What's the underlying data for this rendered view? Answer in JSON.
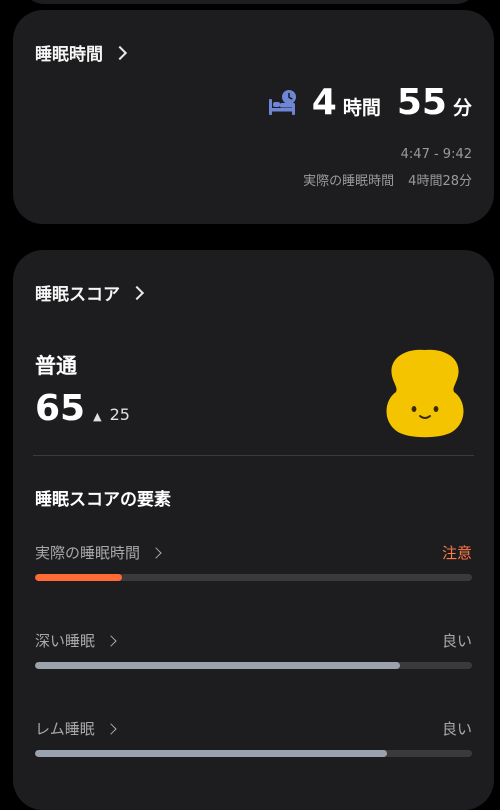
{
  "sleep_time_card": {
    "title": "睡眠時間",
    "hours": "4",
    "hours_unit": "時間",
    "minutes": "55",
    "minutes_unit": "分",
    "time_range": "4:47 - 9:42",
    "actual_label": "実際の睡眠時間",
    "actual_value": "4時間28分"
  },
  "sleep_score_card": {
    "title": "睡眠スコア",
    "rating": "普通",
    "score": "65",
    "delta": "25",
    "factors_title": "睡眠スコアの要素",
    "factors": [
      {
        "label": "実際の睡眠時間",
        "status": "注意",
        "level": 0.2
      },
      {
        "label": "深い睡眠",
        "status": "良い",
        "level": 0.835
      },
      {
        "label": "レム睡眠",
        "status": "良い",
        "level": 0.805
      }
    ]
  },
  "colors": {
    "card_bg": "#1d1d1f",
    "warn": "#ff6a35",
    "good_bar": "#9aa3ad",
    "mascot": "#f5c400",
    "bed_icon": "#6f86d6"
  }
}
